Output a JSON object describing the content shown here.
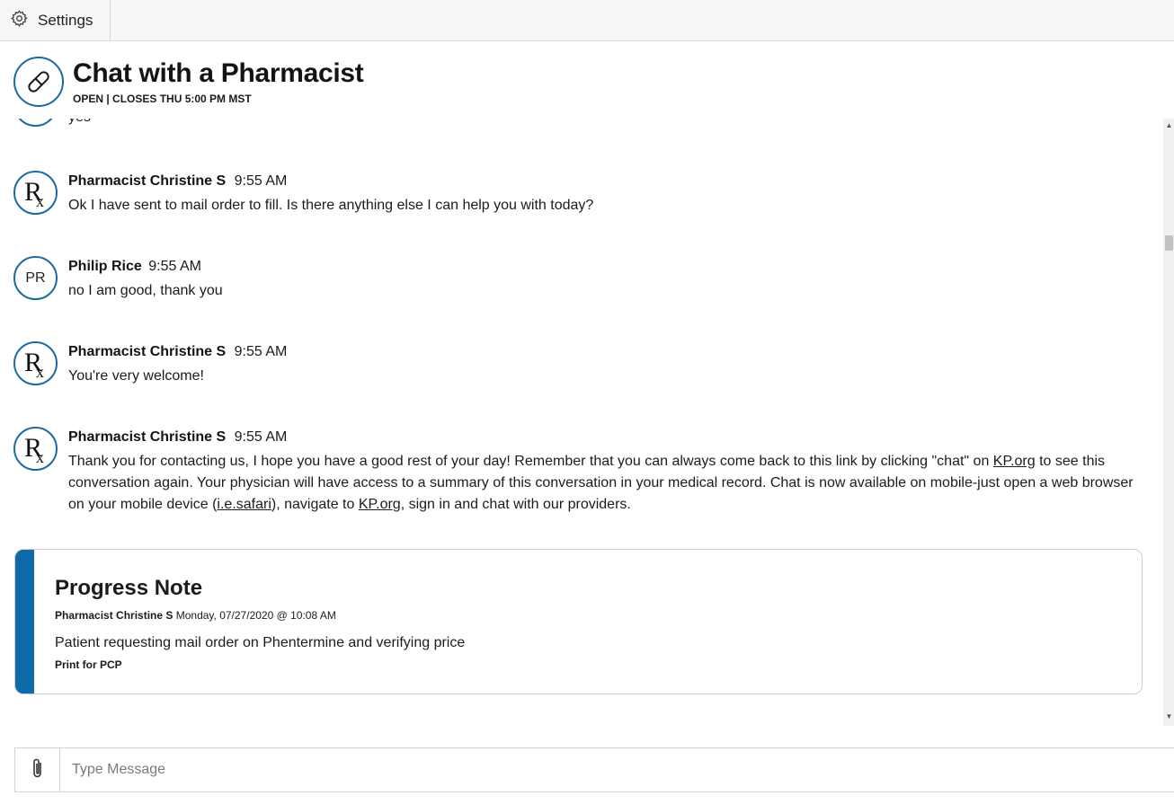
{
  "topbar": {
    "settings_label": "Settings",
    "settings_icon": "gear-icon"
  },
  "header": {
    "title": "Chat with a Pharmacist",
    "status": "OPEN | CLOSES THU 5:00 PM MST",
    "icon": "pill-icon",
    "accent_color": "#1c6aa0"
  },
  "chat": {
    "partial_message_text": "yes",
    "messages": [
      {
        "sender": "Pharmacist Christine S",
        "time": "9:55 AM",
        "avatar": "rx-icon",
        "text": "Ok I have sent to mail order to fill. Is there anything else I can help you with today?"
      },
      {
        "sender": "Philip Rice",
        "time": "9:55 AM",
        "avatar_initials": "PR",
        "text": "no I am good, thank you"
      },
      {
        "sender": "Pharmacist Christine S",
        "time": "9:55 AM",
        "avatar": "rx-icon",
        "text": "You're very welcome!"
      },
      {
        "sender": "Pharmacist Christine S",
        "time": "9:55 AM",
        "avatar": "rx-icon",
        "text_parts": {
          "p1": "Thank you for contacting us, I hope you have a good rest of your day! Remember that you can always come back to this link by clicking \"chat\" on ",
          "link1": "KP.org",
          "p2": " to see this conversation again. Your physician will have access to a summary of this conversation in your medical record. Chat is now available on mobile-just open a web browser on your mobile device (",
          "link2": "i.e.safari",
          "p3": "), navigate to ",
          "link3": "KP.org",
          "p4": ", sign in and chat with our providers."
        }
      }
    ]
  },
  "progress_note": {
    "title": "Progress Note",
    "author": "Pharmacist Christine S",
    "date": "Monday, 07/27/2020 @ 10:08 AM",
    "text": "Patient requesting mail order on Phentermine and verifying price",
    "print_label": "Print for PCP",
    "accent_color": "#0e6aa8"
  },
  "composer": {
    "placeholder": "Type Message",
    "value": "",
    "attach_icon": "paperclip-icon"
  }
}
